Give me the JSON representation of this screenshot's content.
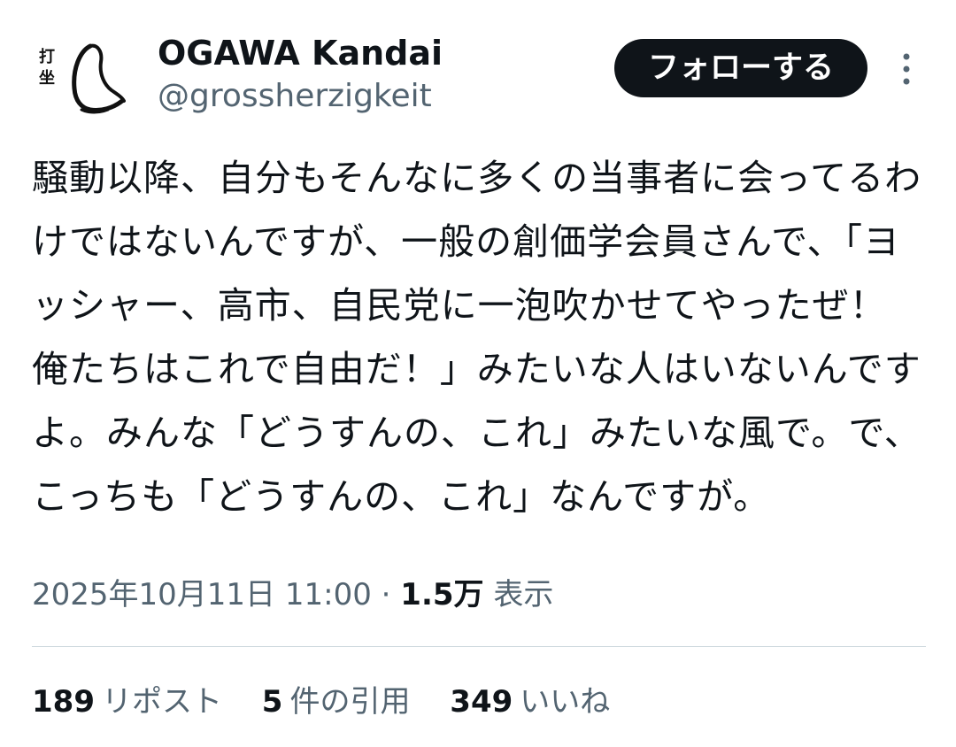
{
  "user": {
    "name": "OGAWA Kandai",
    "handle": "@grossherzigkeit",
    "avatar_text": "打坐"
  },
  "header": {
    "follow_label": "フォローする",
    "more_icon": "more-vertical-icon"
  },
  "tweet": {
    "text": "騒動以降、自分もそんなに多くの当事者に会ってるわけではないんですが、一般の創価学会員さんで、「ヨッシャー、高市、自民党に一泡吹かせてやったぜ！　俺たちはこれで自由だ！」みたいな人はいないんですよ。みんな「どうすんの、これ」みたいな風で。で、こっちも「どうすんの、これ」なんですが。",
    "datetime": "2025年10月11日 11:00",
    "separator": "·",
    "views_count": "1.5万",
    "views_label": "表示"
  },
  "stats": {
    "reposts_count": "189",
    "reposts_label": "リポスト",
    "quotes_count": "5",
    "quotes_label": "件の引用",
    "likes_count": "349",
    "likes_label": "いいね"
  },
  "colors": {
    "text": "#0f1419",
    "secondary": "#536471",
    "button_bg": "#0f1419",
    "divider": "#cfd9de"
  }
}
